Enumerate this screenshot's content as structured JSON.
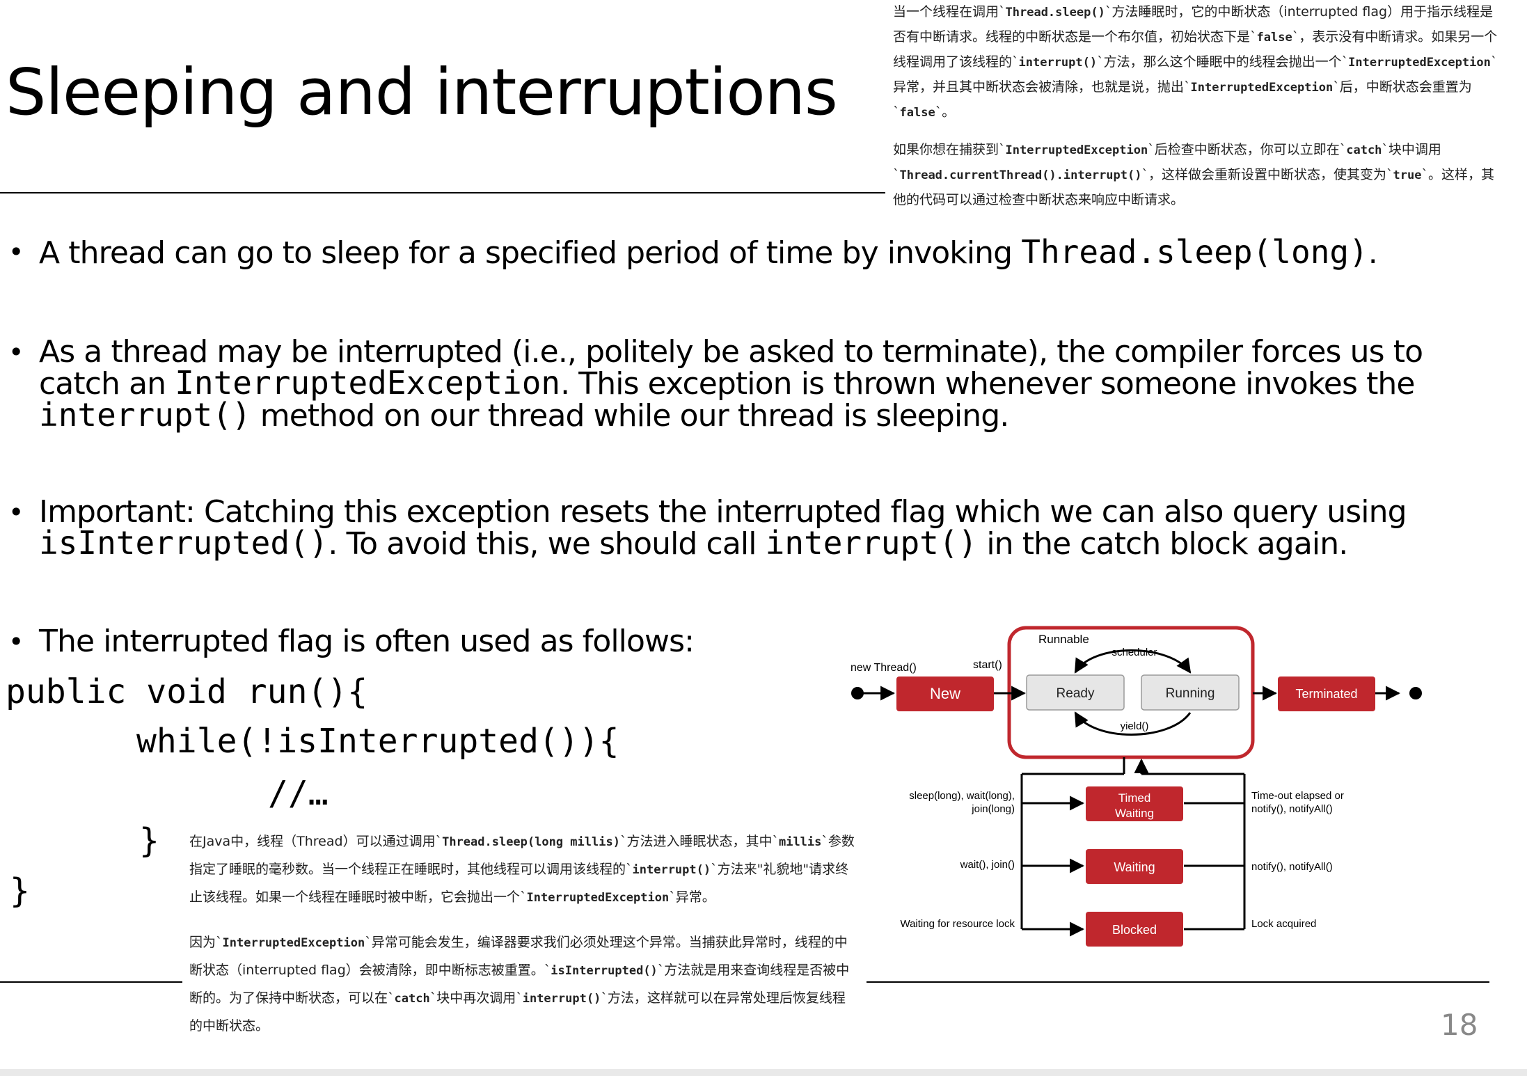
{
  "slide": {
    "title": "Sleeping and interruptions",
    "page_number": "18"
  },
  "note_top": {
    "p1": {
      "t1": "当一个线程在调用`",
      "c1": "Thread.sleep()",
      "t2": "`方法睡眠时，它的中断状态（interrupted flag）用于指示线程是否有中断请求。线程的中断状态是一个布尔值，初始状态下是`",
      "c2": "false",
      "t3": "`，表示没有中断请求。如果另一个线程调用了该线程的`",
      "c3": "interrupt()",
      "t4": "`方法，那么这个睡眠中的线程会抛出一个`",
      "c4": "InterruptedException",
      "t5": "`异常，并且其中断状态会被清除，也就是说，抛出`",
      "c5": "InterruptedException",
      "t6": "`后，中断状态会重置为`",
      "c6": "false",
      "t7": "`。"
    },
    "p2": {
      "t1": "如果你想在捕获到`",
      "c1": "InterruptedException",
      "t2": "`后检查中断状态，你可以立即在`",
      "c2": "catch",
      "t3": "`块中调用`",
      "c3": "Thread.currentThread().interrupt()",
      "t4": "`，这样做会重新设置中断状态，使其变为`",
      "c4": "true",
      "t5": "`。这样，其他的代码可以通过检查中断状态来响应中断请求。"
    }
  },
  "bullets": {
    "b1": {
      "text": "A thread can go to sleep for a specified period of time by invoking ",
      "code": "Thread.sleep(long)",
      "end": "."
    },
    "b2": {
      "t1": "As a thread may be interrupted (i.e., politely be asked to terminate), the compiler forces us to catch an ",
      "c1": "InterruptedException",
      "t2": ". This exception is thrown whenever someone invokes the ",
      "c2": "interrupt()",
      "t3": " method on our thread while our thread is sleeping."
    },
    "b3": {
      "t1": "Important: Catching this exception resets the interrupted flag which we can also query using ",
      "c1": "isInterrupted()",
      "t2": ". To avoid this, we should call ",
      "c2": "interrupt()",
      "t3": " in the catch block again."
    },
    "b4": {
      "text": "The interrupted flag is often used as follows:"
    }
  },
  "code": {
    "line1": "public void run(){",
    "line2": "while(!isInterrupted()){",
    "line3": "//…",
    "line4": "}",
    "line5": "}"
  },
  "note_bottom": {
    "p1": {
      "t1": "在Java中，线程（Thread）可以通过调用`",
      "c1": "Thread.sleep(long millis)",
      "t2": "`方法进入睡眠状态，其中`",
      "c2": "millis",
      "t3": "`参数指定了睡眠的毫秒数。当一个线程正在睡眠时，其他线程可以调用该线程的`",
      "c3": "interrupt()",
      "t4": "`方法来\"礼貌地\"请求终止该线程。如果一个线程在睡眠时被中断，它会抛出一个`",
      "c4": "InterruptedException",
      "t5": "`异常。"
    },
    "p2": {
      "t1": "因为`",
      "c1": "InterruptedException",
      "t2": "`异常可能会发生，编译器要求我们必须处理这个异常。当捕获此异常时，线程的中断状态（interrupted flag）会被清除，即中断标志被重置。`",
      "c2": "isInterrupted()",
      "t3": "`方法就是用来查询线程是否被中断的。为了保持中断状态，可以在`",
      "c3": "catch",
      "t4": "`块中再次调用`",
      "c4": "interrupt()",
      "t5": "`方法，这样就可以在异常处理后恢复线程的中断状态。"
    }
  },
  "diagram": {
    "colors": {
      "state_red": "#c0272d",
      "state_gray": "#e6e6e6",
      "line": "#000000"
    },
    "group_label": "Runnable",
    "new_thread_label": "new Thread()",
    "start_label": "start()",
    "scheduler_label": "scheduler",
    "yield_label": "yield()",
    "states": {
      "new": "New",
      "ready": "Ready",
      "running": "Running",
      "terminated": "Terminated",
      "timed_waiting_1": "Timed",
      "timed_waiting_2": "Waiting",
      "waiting": "Waiting",
      "blocked": "Blocked"
    },
    "left_labels": {
      "sleep_1": "sleep(long), wait(long),",
      "sleep_2": "join(long)",
      "wait": "wait(), join()",
      "lock": "Waiting for resource lock"
    },
    "right_labels": {
      "timeout_1": "Time-out elapsed or",
      "timeout_2": "notify(), notifyAll()",
      "notify": "notify(), notifyAll()",
      "acquired": "Lock acquired"
    }
  }
}
